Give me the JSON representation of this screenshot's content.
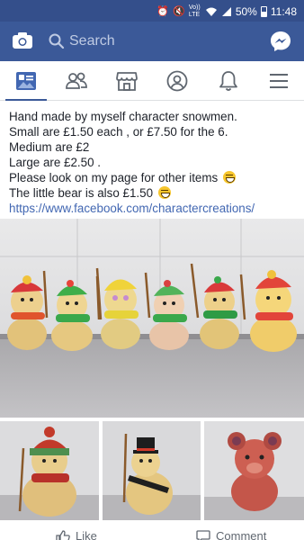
{
  "status_bar": {
    "network_label": "Vo)) LTE",
    "battery": "50%",
    "time": "11:48"
  },
  "header": {
    "search_placeholder": "Search",
    "brand_color": "#3b5998"
  },
  "tabs": [
    {
      "name": "news-feed",
      "icon": "news-feed-icon",
      "active": true
    },
    {
      "name": "friends",
      "icon": "friends-icon",
      "active": false
    },
    {
      "name": "marketplace",
      "icon": "marketplace-icon",
      "active": false
    },
    {
      "name": "profile",
      "icon": "profile-icon",
      "active": false
    },
    {
      "name": "notifications",
      "icon": "bell-icon",
      "active": false
    },
    {
      "name": "menu",
      "icon": "menu-icon",
      "active": false
    }
  ],
  "post": {
    "lines": [
      "Hand made by myself character snowmen.",
      "Small are £1.50 each , or £7.50 for the 6.",
      "Medium are £2",
      "Large are £2.50 .",
      "Please look on my page for other items",
      "The little bear is also £1.50"
    ],
    "link": "https://www.facebook.com/charactercreations/"
  },
  "actions": {
    "like": "Like",
    "comment": "Comment"
  }
}
